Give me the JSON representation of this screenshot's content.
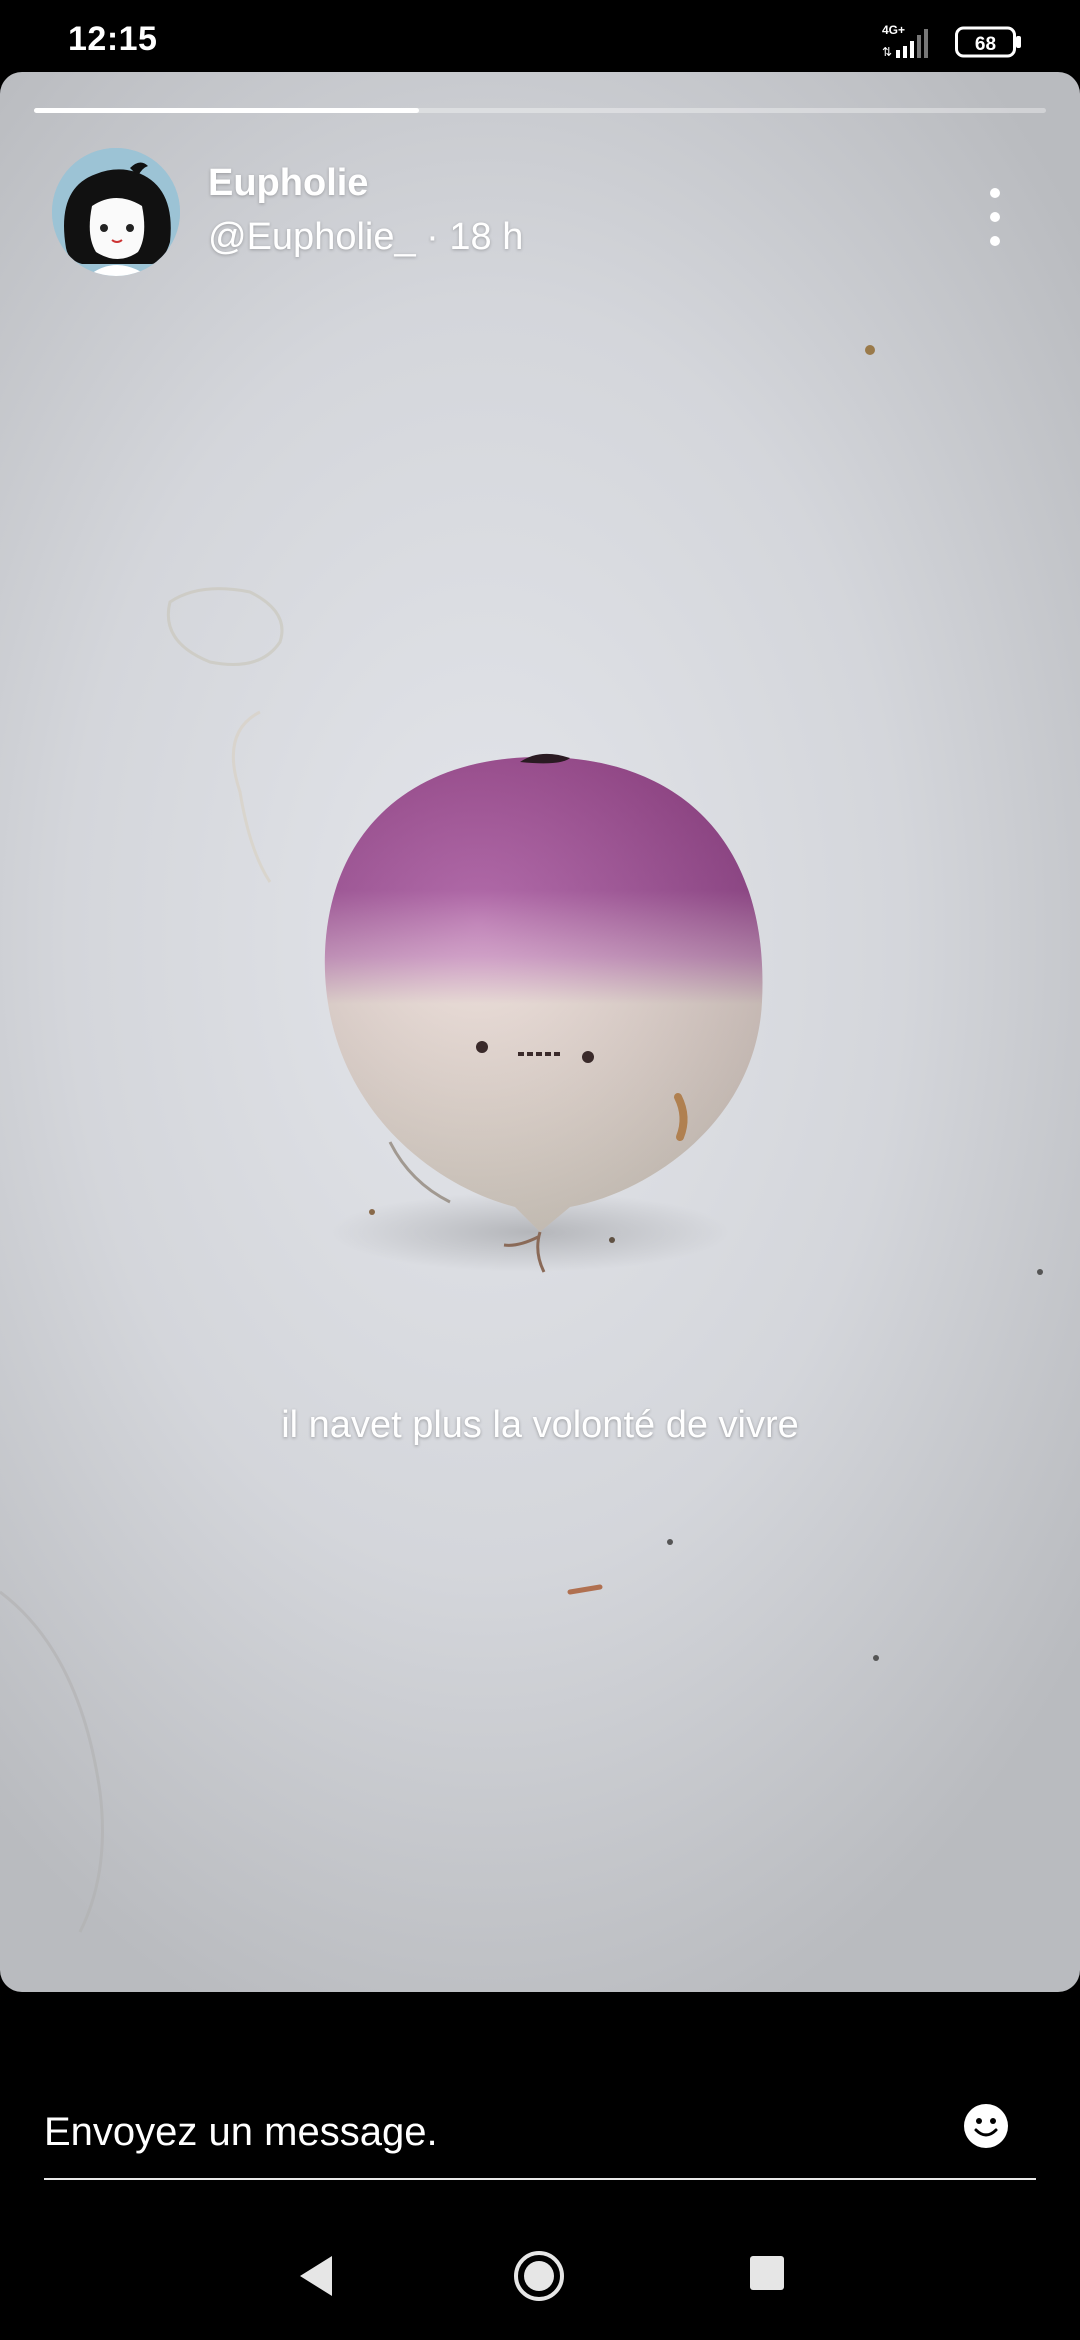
{
  "status_bar": {
    "time": "12:15",
    "network": "4G+",
    "battery_level": "68"
  },
  "story": {
    "progress_fraction": 0.38,
    "author": {
      "display_name": "Eupholie",
      "handle": "@Eupholie_",
      "separator": "·",
      "posted_ago": "18 h"
    },
    "caption": "il navet plus la volonté de vivre",
    "image_subject": "turnip-photo"
  },
  "reply": {
    "placeholder": "Envoyez un message."
  },
  "icons": {
    "more": "more-vertical-icon",
    "emoji": "emoji-icon",
    "back": "back-icon",
    "home": "home-icon",
    "recents": "recents-icon"
  },
  "colors": {
    "background": "#000000",
    "text": "#ffffff"
  }
}
